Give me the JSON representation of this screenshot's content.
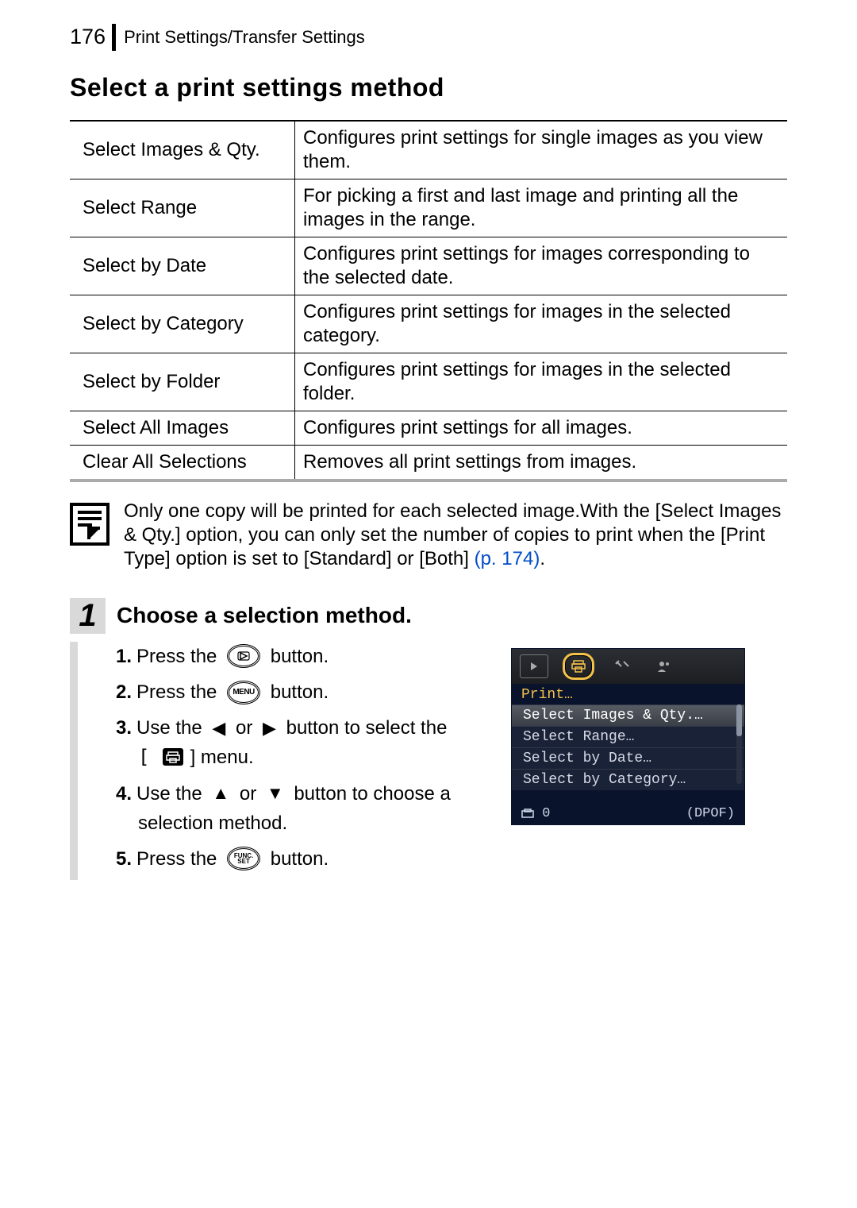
{
  "header": {
    "page_number": "176",
    "section": "Print Settings/Transfer Settings"
  },
  "heading": "Select a print settings method",
  "methods": [
    {
      "name": "Select Images & Qty.",
      "desc": "Configures print settings for single images as you view them."
    },
    {
      "name": "Select Range",
      "desc": "For picking a first and last image and printing all the images in the range."
    },
    {
      "name": "Select by Date",
      "desc": "Configures print settings for images corresponding to the selected date."
    },
    {
      "name": "Select by Category",
      "desc": "Configures print settings for images in the selected category."
    },
    {
      "name": "Select by Folder",
      "desc": "Configures print settings for images in the selected folder."
    },
    {
      "name": "Select All Images",
      "desc": "Configures print settings for all images."
    },
    {
      "name": "Clear All Selections",
      "desc": "Removes all print settings from images."
    }
  ],
  "note": {
    "text": "Only one copy will be printed for each selected image.With the [Select Images & Qty.] option, you can only set the number of copies to print when the [Print Type] option is set to [Standard] or [Both] ",
    "ref": "(p. 174)",
    "tail": "."
  },
  "step": {
    "number": "1",
    "title": "Choose a selection method.",
    "ins1": {
      "n": "1.",
      "a": "Press the ",
      "icon": "playback-button-icon",
      "b": " button."
    },
    "ins2": {
      "n": "2.",
      "a": "Press the ",
      "icon": "menu-button-icon",
      "icon_label": "MENU",
      "b": " button."
    },
    "ins3": {
      "n": "3.",
      "a": "Use the ",
      "mid": " or ",
      "b": " button to select the",
      "c": "] menu."
    },
    "ins4": {
      "n": "4.",
      "a": "Use the ",
      "mid": " or ",
      "b": " button to choose a",
      "c": "selection method."
    },
    "ins5": {
      "n": "5.",
      "a": "Press the ",
      "icon": "func-set-button-icon",
      "icon_label_top": "FUNC.",
      "icon_label_bottom": "SET",
      "b": " button."
    }
  },
  "cam": {
    "title": "Print…",
    "items": [
      "Select Images & Qty.…",
      "Select Range…",
      "Select by Date…",
      "Select by Category…"
    ],
    "footer_left": "0",
    "footer_right": "(DPOF)"
  }
}
